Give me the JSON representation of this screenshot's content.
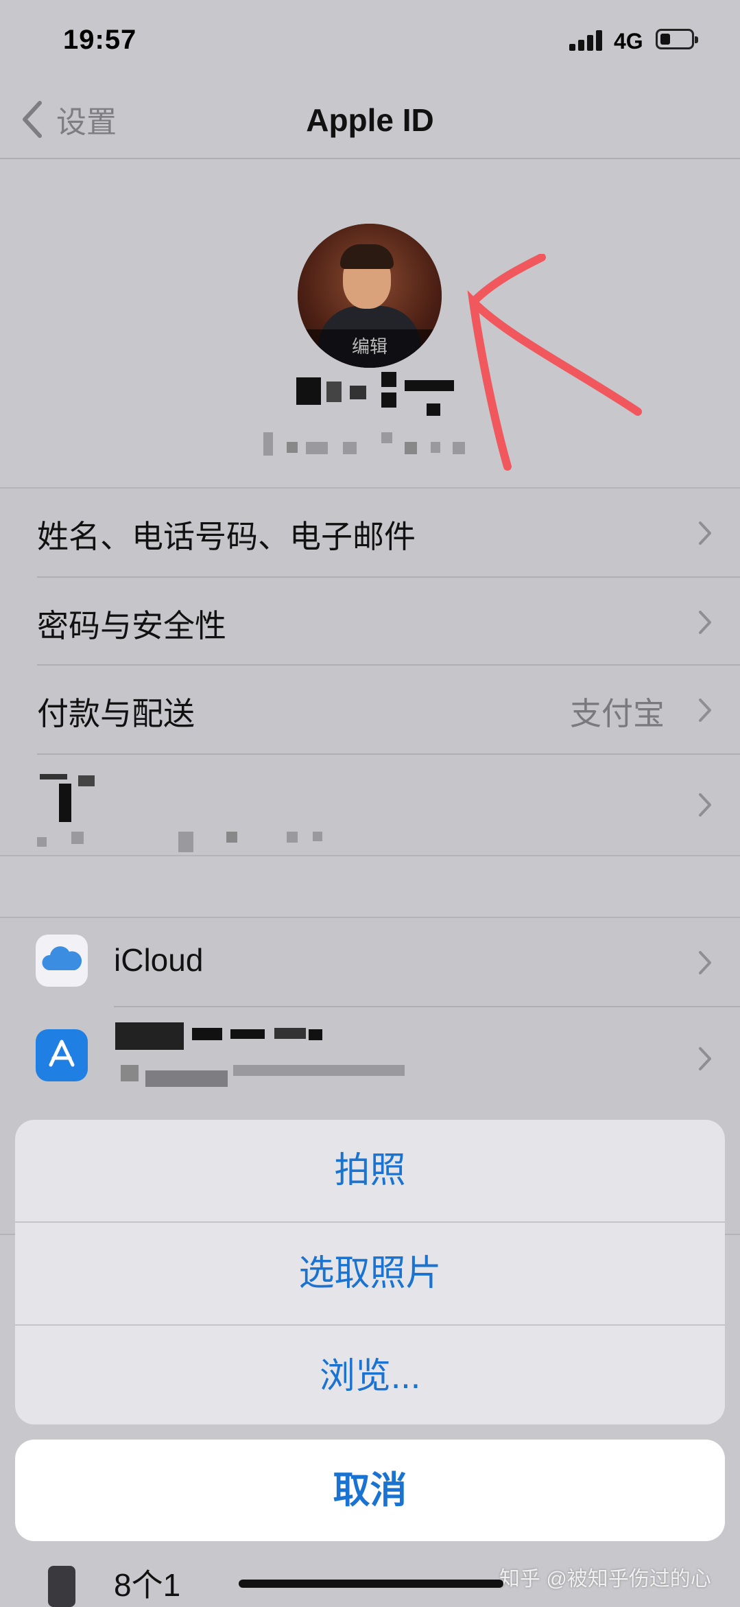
{
  "status_bar": {
    "time": "19:57",
    "network": "4G"
  },
  "nav": {
    "back_label": "设置",
    "title": "Apple ID"
  },
  "profile": {
    "avatar_overlay": "编辑"
  },
  "account_rows": [
    {
      "label": "姓名、电话号码、电子邮件",
      "value": ""
    },
    {
      "label": "密码与安全性",
      "value": ""
    },
    {
      "label": "付款与配送",
      "value": "支付宝"
    }
  ],
  "services_rows": [
    {
      "label": "iCloud",
      "icon": "icloud-icon"
    }
  ],
  "partial_rows": {
    "device_count": "8个1"
  },
  "action_sheet": {
    "options": [
      "拍照",
      "选取照片",
      "浏览..."
    ],
    "cancel": "取消"
  },
  "watermark": "知乎 @被知乎伤过的心",
  "colors": {
    "accent": "#1a73d1",
    "annotation_arrow": "#f0585e"
  }
}
